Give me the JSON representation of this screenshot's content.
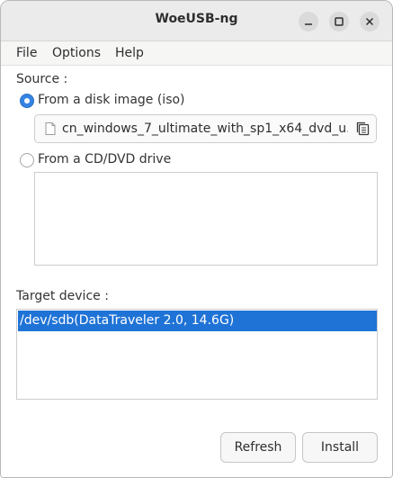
{
  "window": {
    "title": "WoeUSB-ng"
  },
  "menu": {
    "items": [
      {
        "label": "File"
      },
      {
        "label": "Options"
      },
      {
        "label": "Help"
      }
    ]
  },
  "source": {
    "label": "Source :",
    "disk_image_option": "From a disk image (iso)",
    "disk_image_selected": true,
    "file_value": "cn_windows_7_ultimate_with_sp1_x64_dvd_u...",
    "cd_drive_option": "From a CD/DVD drive",
    "cd_drive_selected": false
  },
  "target": {
    "label": "Target device :",
    "devices": [
      "/dev/sdb(DataTraveler 2.0, 14.6G)"
    ],
    "selected_index": 0
  },
  "buttons": {
    "refresh": "Refresh",
    "install": "Install"
  },
  "colors": {
    "accent": "#3584e4",
    "selection": "#1f73d6"
  },
  "icons": {
    "minimize": "minimize-icon",
    "maximize": "maximize-icon",
    "close": "close-icon",
    "file": "file-icon",
    "file_chooser": "file-chooser-icon"
  }
}
